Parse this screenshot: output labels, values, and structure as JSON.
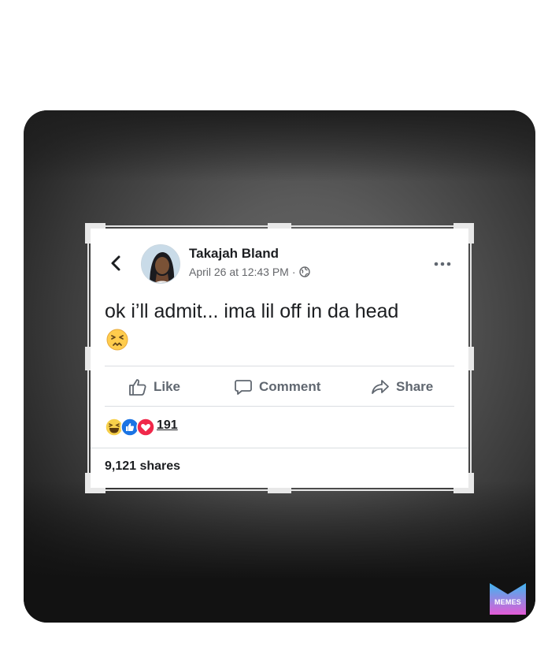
{
  "post": {
    "author_name": "Takajah Bland",
    "timestamp": "April 26 at 12:43 PM",
    "separator": "·",
    "audience_icon": "globe-icon",
    "text": "ok i’ll admit... ima lil off in da head",
    "emoji": "persevering-face-emoji"
  },
  "actions": {
    "like_label": "Like",
    "comment_label": "Comment",
    "share_label": "Share"
  },
  "reactions": {
    "icons": [
      "haha-reaction-icon",
      "like-reaction-icon",
      "love-reaction-icon"
    ],
    "count": "191"
  },
  "shares_text": "9,121 shares",
  "watermark": {
    "label": "MEMES",
    "colors": {
      "top": "#3fb6f0",
      "bottom": "#e35bd6"
    }
  }
}
